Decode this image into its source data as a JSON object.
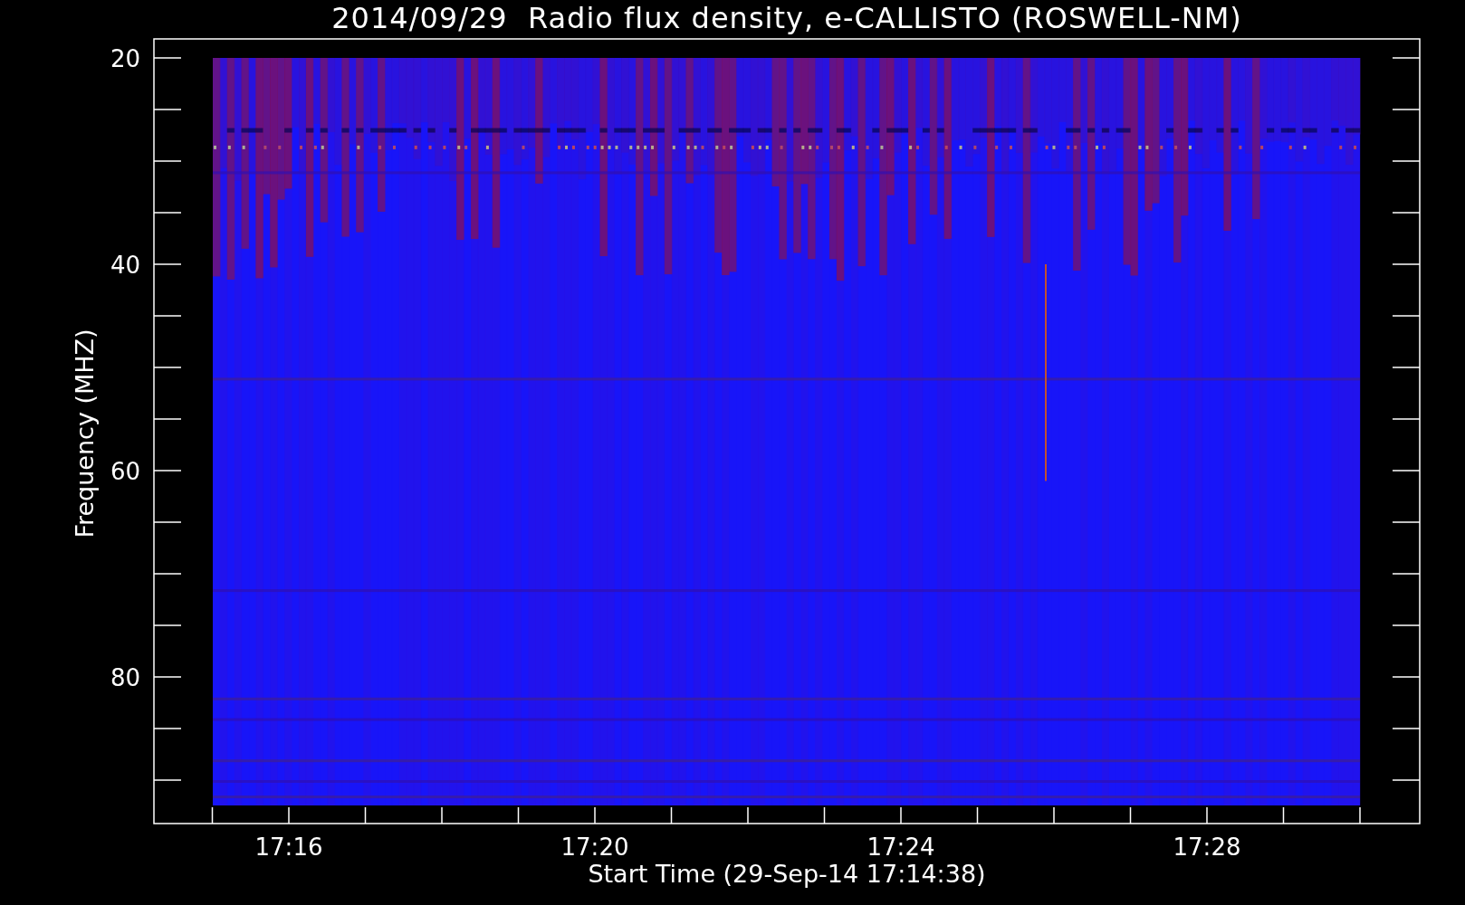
{
  "plot": {
    "title": "2014/09/29  Radio flux density, e-CALLISTO (ROSWELL-NM)",
    "xlabel": "Start Time (29-Sep-14 17:14:38)",
    "ylabel": "Frequency (MHZ)",
    "xtick_labels": [
      {
        "label": "17:16"
      },
      {
        "label": "17:20"
      },
      {
        "label": "17:24"
      },
      {
        "label": "17:28"
      }
    ],
    "ytick_labels": [
      {
        "label": "20"
      },
      {
        "label": "40"
      },
      {
        "label": "60"
      },
      {
        "label": "80"
      }
    ]
  }
}
